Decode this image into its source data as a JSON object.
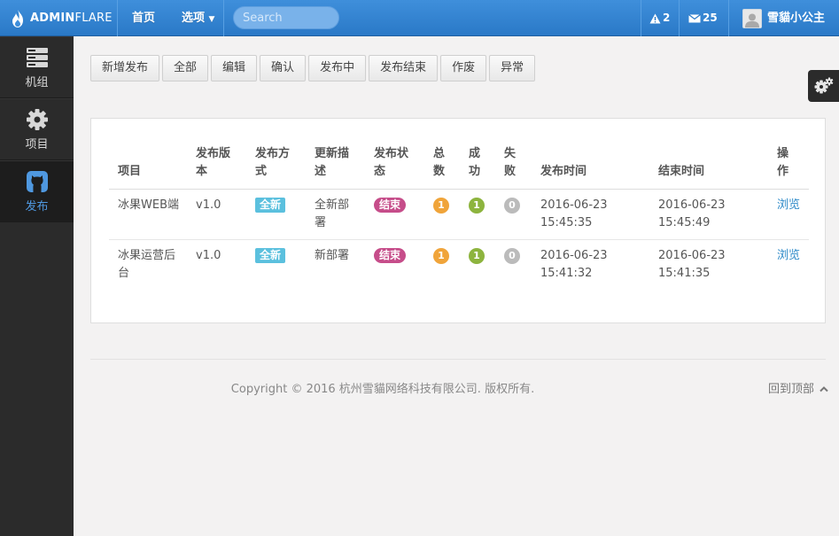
{
  "brand": {
    "part1": "ADMIN",
    "part2": "FLARE"
  },
  "nav": {
    "home": "首页",
    "options": "选项"
  },
  "search": {
    "placeholder": "Search"
  },
  "header_right": {
    "alerts": "2",
    "messages": "25",
    "user": "雪貓小公主"
  },
  "sidebar": {
    "items": [
      {
        "label": "机组",
        "icon": "server-icon"
      },
      {
        "label": "项目",
        "icon": "gear-icon"
      },
      {
        "label": "发布",
        "icon": "github-icon"
      }
    ]
  },
  "toolbar": {
    "buttons": [
      "新增发布",
      "全部",
      "编辑",
      "确认",
      "发布中",
      "发布结束",
      "作废",
      "异常"
    ]
  },
  "table": {
    "headers": {
      "project": "项目",
      "version": [
        "发布版",
        "本"
      ],
      "method": [
        "发布方",
        "式"
      ],
      "desc": [
        "更新描",
        "述"
      ],
      "status": [
        "发布状",
        "态"
      ],
      "total": [
        "总",
        "数"
      ],
      "success": [
        "成",
        "功"
      ],
      "fail": [
        "失",
        "败"
      ],
      "start": "发布时间",
      "end": "结束时间",
      "op": [
        "操",
        "作"
      ]
    },
    "rows": [
      {
        "project": "冰果WEB端",
        "version": "v1.0",
        "method": "全新",
        "desc": [
          "全新部",
          "署"
        ],
        "status": "结束",
        "total": "1",
        "success": "1",
        "fail": "0",
        "start": [
          "2016-06-23",
          "15:45:35"
        ],
        "end": [
          "2016-06-23",
          "15:45:49"
        ],
        "op": "浏览"
      },
      {
        "project": [
          "冰果运营后",
          "台"
        ],
        "version": "v1.0",
        "method": "全新",
        "desc": [
          "新部署",
          ""
        ],
        "status": "结束",
        "total": "1",
        "success": "1",
        "fail": "0",
        "start": [
          "2016-06-23",
          "15:41:32"
        ],
        "end": [
          "2016-06-23",
          "15:41:35"
        ],
        "op": "浏览"
      }
    ]
  },
  "footer": {
    "copyright": "Copyright © 2016 杭州雪貓网络科技有限公司. 版权所有.",
    "totop": "回到顶部"
  },
  "colors": {
    "topbar": "#2a79c7",
    "sidebar": "#2b2b2b",
    "accent": "#4f98e0",
    "label_info": "#5bc0de",
    "label_end": "#c64d8a"
  }
}
